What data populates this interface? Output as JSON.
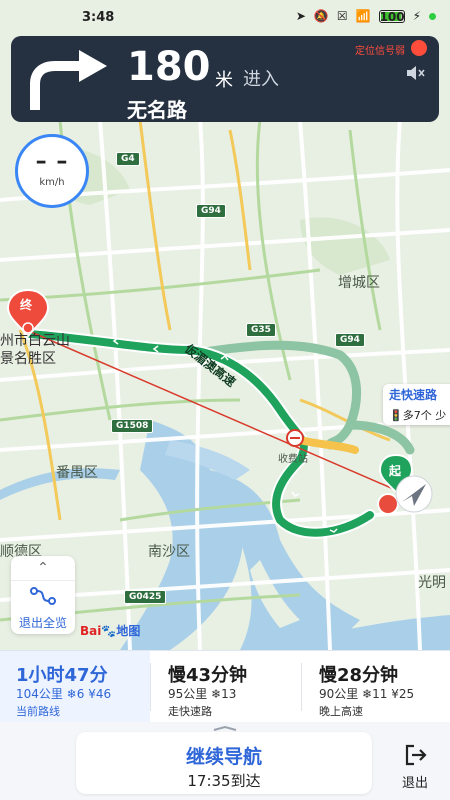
{
  "status_bar": {
    "time": "3:48",
    "battery": "100"
  },
  "nav_card": {
    "distance": "180",
    "distance_unit": "米",
    "action": "进入",
    "road_name": "无名路",
    "gps_status": "定位信号弱",
    "turn_icon": "turn-right-arrow-icon",
    "mute_icon": "speaker-muted-icon"
  },
  "speed": {
    "value": "– –",
    "unit": "km/h"
  },
  "map": {
    "labels": {
      "zengcheng": "增城区",
      "panyu": "番禺区",
      "nansha": "南沙区",
      "shunde": "顺德区",
      "guangming": "光明",
      "baiyun_line1": "州市白云山",
      "baiyun_line2": "景名胜区",
      "tollgate": "收费站"
    },
    "highways": {
      "g4": "G4",
      "g94a": "G94",
      "g35": "G35",
      "g94b": "G94",
      "g1508": "G1508",
      "g0425": "G0425"
    },
    "road_overlay": "仮湄澳高速",
    "end_marker": "终",
    "start_marker": "起",
    "route_tag": {
      "title": "走快速路",
      "subtitle": "多7个 少"
    }
  },
  "overview": {
    "label": "退出全览"
  },
  "logo": {
    "part1": "Bai",
    "part2": "地图"
  },
  "routes": [
    {
      "time": "1小时47分",
      "meta": "104公里 ❄6 ¥46",
      "note": "当前路线",
      "active": true
    },
    {
      "time": "慢43分钟",
      "meta": "95公里 ❄13",
      "note": "走快速路",
      "active": false
    },
    {
      "time": "慢28分钟",
      "meta": "90公里 ❄11 ¥25",
      "note": "晚上高速",
      "active": false
    }
  ],
  "bottom": {
    "continue": "继续导航",
    "arrival": "17:35到达",
    "exit": "退出"
  },
  "colors": {
    "accent": "#2f66d8",
    "route_green": "#1fa35c",
    "alt_route": "#8cc4a4",
    "nav_bg": "#253040",
    "warning": "#ff4d3b"
  }
}
